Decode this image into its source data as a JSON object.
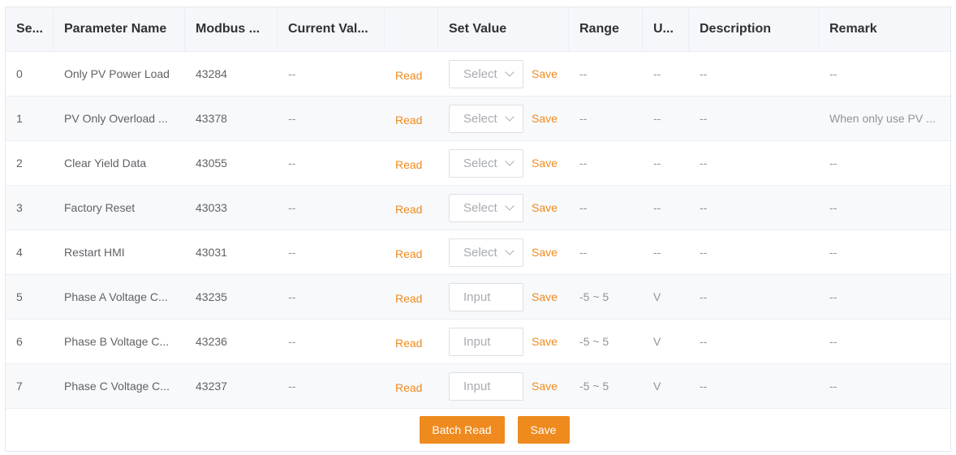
{
  "headers": [
    "Se...",
    "Parameter Name",
    "Modbus ...",
    "Current Val...",
    "",
    "Set Value",
    "Range",
    "U...",
    "Description",
    "Remark"
  ],
  "rows": [
    {
      "seq": "0",
      "name": "Only PV Power Load",
      "modbus": "43284",
      "current": "--",
      "read": "Read",
      "control": "Select",
      "control_type": "select",
      "save": "Save",
      "range": "--",
      "unit": "--",
      "description": "--",
      "remark": "--"
    },
    {
      "seq": "1",
      "name": "PV Only Overload ...",
      "modbus": "43378",
      "current": "--",
      "read": "Read",
      "control": "Select",
      "control_type": "select",
      "save": "Save",
      "range": "--",
      "unit": "--",
      "description": "--",
      "remark": "When only use PV ..."
    },
    {
      "seq": "2",
      "name": "Clear Yield Data",
      "modbus": "43055",
      "current": "--",
      "read": "Read",
      "control": "Select",
      "control_type": "select",
      "save": "Save",
      "range": "--",
      "unit": "--",
      "description": "--",
      "remark": "--"
    },
    {
      "seq": "3",
      "name": "Factory Reset",
      "modbus": "43033",
      "current": "--",
      "read": "Read",
      "control": "Select",
      "control_type": "select",
      "save": "Save",
      "range": "--",
      "unit": "--",
      "description": "--",
      "remark": "--"
    },
    {
      "seq": "4",
      "name": "Restart HMI",
      "modbus": "43031",
      "current": "--",
      "read": "Read",
      "control": "Select",
      "control_type": "select",
      "save": "Save",
      "range": "--",
      "unit": "--",
      "description": "--",
      "remark": "--"
    },
    {
      "seq": "5",
      "name": "Phase A Voltage C...",
      "modbus": "43235",
      "current": "--",
      "read": "Read",
      "control": "Input",
      "control_type": "input",
      "save": "Save",
      "range": "-5 ~ 5",
      "unit": "V",
      "description": "--",
      "remark": "--"
    },
    {
      "seq": "6",
      "name": "Phase B Voltage C...",
      "modbus": "43236",
      "current": "--",
      "read": "Read",
      "control": "Input",
      "control_type": "input",
      "save": "Save",
      "range": "-5 ~ 5",
      "unit": "V",
      "description": "--",
      "remark": "--"
    },
    {
      "seq": "7",
      "name": "Phase C Voltage C...",
      "modbus": "43237",
      "current": "--",
      "read": "Read",
      "control": "Input",
      "control_type": "input",
      "save": "Save",
      "range": "-5 ~ 5",
      "unit": "V",
      "description": "--",
      "remark": "--"
    }
  ],
  "footer": {
    "batch_read_label": "Batch Read",
    "save_label": "Save"
  },
  "colors": {
    "accent": "#ee8a1e",
    "header_bg": "#f5f7fa",
    "row_alt_bg": "#f8f9fb"
  }
}
